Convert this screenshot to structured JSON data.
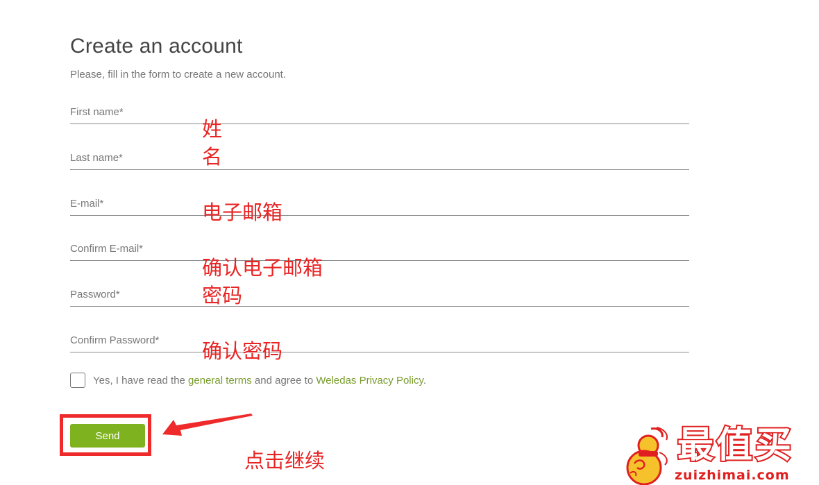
{
  "header": {
    "title": "Create an account",
    "intro": "Please, fill in the form to create a new account."
  },
  "form": {
    "first_name": "First name*",
    "last_name": "Last name*",
    "email": "E-mail*",
    "confirm_email": "Confirm E-mail*",
    "password": "Password*",
    "confirm_password": "Confirm Password*",
    "terms_prefix": "Yes, I have read the ",
    "terms_link": "general terms",
    "terms_middle": " and agree to ",
    "privacy_link": "Weledas Privacy Policy",
    "terms_suffix": ".",
    "send_label": "Send"
  },
  "annotations": {
    "name": "姓名",
    "email": "电子邮箱",
    "confirm_email": "确认电子邮箱",
    "password": "密码",
    "confirm_password": "确认密码",
    "click_continue": "点击继续"
  },
  "watermark": {
    "brand": "最值买",
    "url": "zuizhimai.com"
  },
  "colors": {
    "annotation_red": "#e82525",
    "link_green": "#7a9c2e",
    "button_green": "#7fb21f"
  }
}
